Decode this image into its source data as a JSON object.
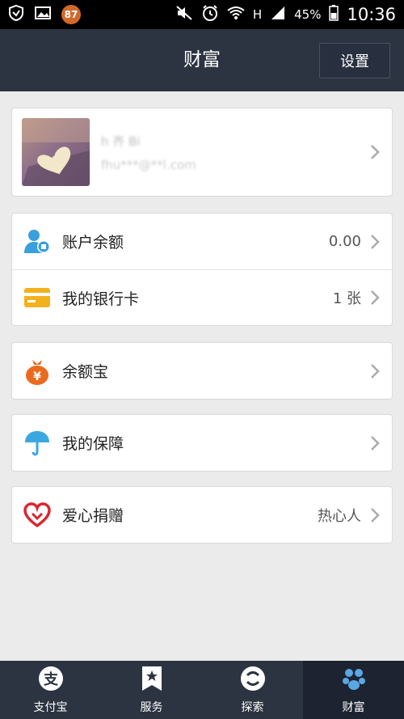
{
  "status_bar": {
    "notification_count": "87",
    "signal_label": "H",
    "battery": "45%",
    "time": "10:36"
  },
  "header": {
    "title": "财富",
    "settings_label": "设置"
  },
  "profile": {
    "name": "h 齐 Bi",
    "email": "fhu***@**l.com"
  },
  "account": {
    "balance_label": "账户余额",
    "balance_value": "0.00",
    "bank_card_label": "我的银行卡",
    "bank_card_value": "1 张"
  },
  "yuebao": {
    "label": "余额宝"
  },
  "insurance": {
    "label": "我的保障"
  },
  "charity": {
    "label": "爱心捐赠",
    "value": "热心人"
  },
  "tabs": [
    {
      "label": "支付宝",
      "icon": "alipay-icon"
    },
    {
      "label": "服务",
      "icon": "star-icon"
    },
    {
      "label": "探索",
      "icon": "explore-icon"
    },
    {
      "label": "财富",
      "icon": "wealth-icon"
    }
  ],
  "colors": {
    "header_bg": "#2c3341",
    "balance_icon": "#3a9fdc",
    "card_icon": "#f2b21c",
    "yuebao_icon": "#ec6a1e",
    "insurance_icon": "#3aa8e0",
    "charity_icon": "#d9282e"
  }
}
